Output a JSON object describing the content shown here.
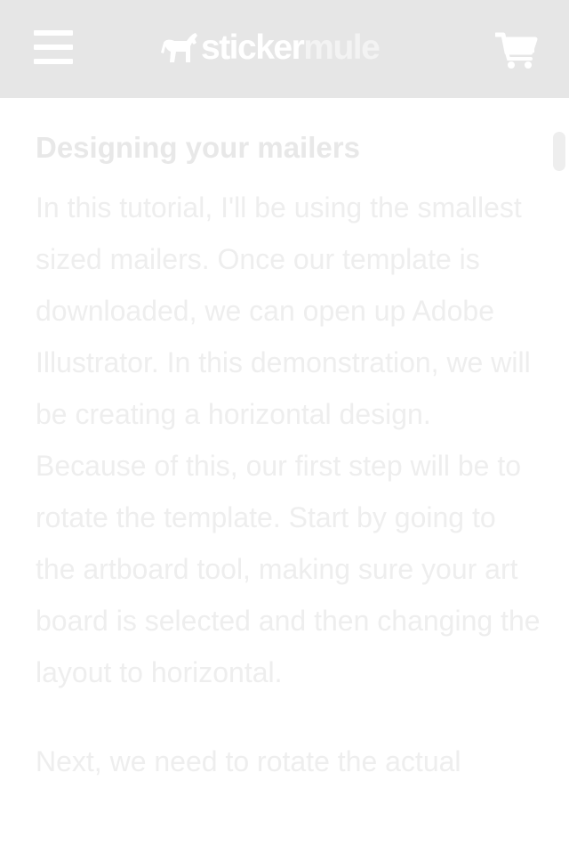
{
  "header": {
    "logo": {
      "part1": "sticker",
      "part2": "mule"
    },
    "menu_icon": "hamburger-menu-icon",
    "cart_icon": "shopping-cart-icon"
  },
  "article": {
    "heading": "Designing your mailers",
    "paragraphs": [
      "In this tutorial, I'll be using the smallest sized mailers. Once our template is downloaded, we can open up Adobe Illustrator. In this demonstration, we will be creating a horizontal design. Because of this, our first step will be to rotate the template. Start by going to the artboard tool, making sure your art board is selected and then changing the layout to horizontal.",
      "Next, we need to rotate the actual"
    ]
  },
  "colors": {
    "header_bg": "#e6e6e6",
    "text": "#eeeeee",
    "heading": "#e8e8e8"
  }
}
